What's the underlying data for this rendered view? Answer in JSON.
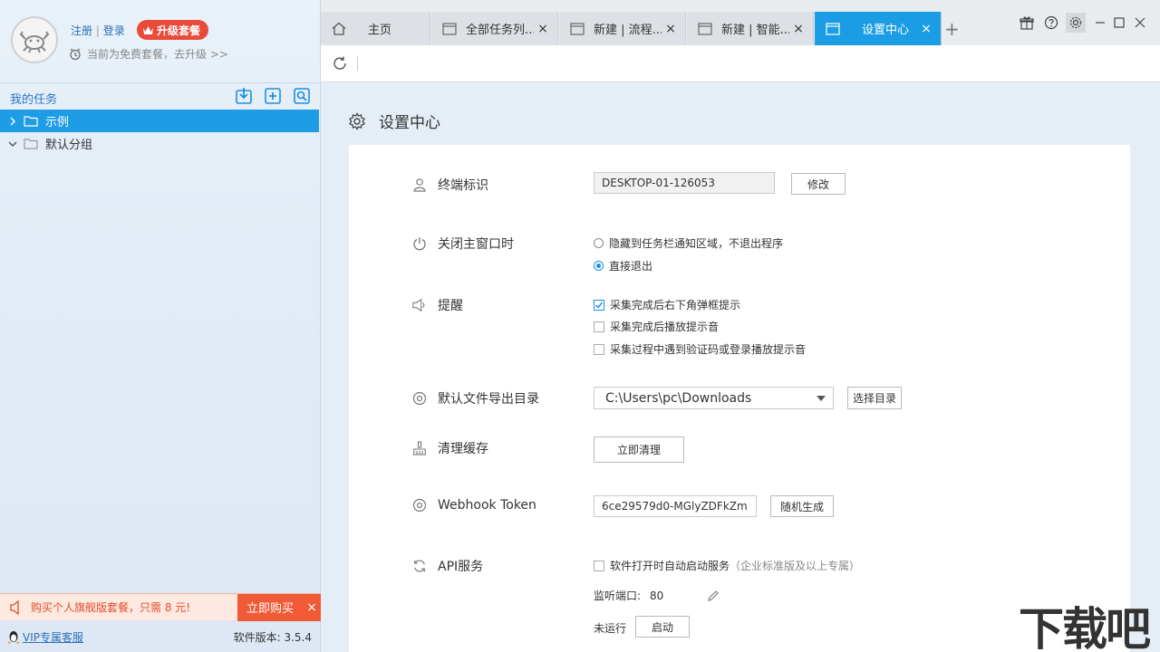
{
  "sidebar": {
    "auth": {
      "register": "注册",
      "sep": "|",
      "login": "登录"
    },
    "upgrade_label": "升级套餐",
    "plan_text": "当前为免费套餐，去升级 >>",
    "tasks_title": "我的任务",
    "tree": [
      {
        "label": "示例",
        "expanded": false,
        "selected": true
      },
      {
        "label": "默认分组",
        "expanded": true,
        "selected": false
      }
    ],
    "promo_text": "购买个人旗舰版套餐，只需 8 元!",
    "promo_buy": "立即购买",
    "promo_close": "×",
    "vip_link": "VIP专属客服",
    "version": "软件版本: 3.5.4"
  },
  "tabs": [
    {
      "label": "主页",
      "icon": "home-icon",
      "closable": false,
      "active": false
    },
    {
      "label": "全部任务列...",
      "icon": "window-icon",
      "closable": true,
      "active": false
    },
    {
      "label": "新建 | 流程...",
      "icon": "window-icon",
      "closable": true,
      "active": false
    },
    {
      "label": "新建 | 智能...",
      "icon": "window-icon",
      "closable": true,
      "active": false
    },
    {
      "label": "设置中心",
      "icon": "window-icon",
      "closable": true,
      "active": true
    }
  ],
  "tab_close": "×",
  "new_tab": "+",
  "page": {
    "title": "设置中心",
    "terminal": {
      "label": "终端标识",
      "value": "DESKTOP-01-126053",
      "button": "修改"
    },
    "close_behavior": {
      "label": "关闭主窗口时",
      "options": [
        {
          "text": "隐藏到任务栏通知区域，不退出程序",
          "selected": false
        },
        {
          "text": "直接退出",
          "selected": true
        }
      ]
    },
    "reminder": {
      "label": "提醒",
      "options": [
        {
          "text": "采集完成后右下角弹框提示",
          "checked": true
        },
        {
          "text": "采集完成后播放提示音",
          "checked": false
        },
        {
          "text": "采集过程中遇到验证码或登录播放提示音",
          "checked": false
        }
      ]
    },
    "export_dir": {
      "label": "默认文件导出目录",
      "value": "C:\\Users\\pc\\Downloads",
      "button": "选择目录"
    },
    "cache": {
      "label": "清理缓存",
      "button": "立即清理"
    },
    "webhook": {
      "label": "Webhook Token",
      "value": "6ce29579d0-MGlyZDFkZm",
      "button": "随机生成"
    },
    "api": {
      "label": "API服务",
      "autostart": "软件打开时自动启动服务",
      "autostart_note": "（企业标准版及以上专属）",
      "autostart_checked": false,
      "port_label": "监听端口:",
      "port_value": "80",
      "status": "未运行",
      "start_button": "启动"
    }
  },
  "watermark": "下载吧"
}
